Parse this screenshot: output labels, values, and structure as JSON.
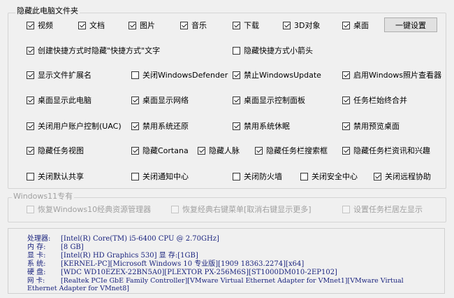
{
  "group1": {
    "title": "隐藏此电脑文件夹",
    "folders": [
      {
        "label": "视频",
        "checked": true
      },
      {
        "label": "文档",
        "checked": true
      },
      {
        "label": "图片",
        "checked": true
      },
      {
        "label": "音乐",
        "checked": true
      },
      {
        "label": "下载",
        "checked": true
      },
      {
        "label": "3D对象",
        "checked": true
      },
      {
        "label": "桌面",
        "checked": true
      }
    ],
    "one_click_label": "一键设置",
    "options": [
      {
        "label": "创建快捷方式时隐藏\"快捷方式\"文字",
        "checked": true
      },
      {
        "label": "隐藏快捷方式小箭头",
        "checked": false
      },
      {
        "label": "显示文件扩展名",
        "checked": true
      },
      {
        "label": "关闭WindowsDefender",
        "checked": false
      },
      {
        "label": "禁止WindowsUpdate",
        "checked": true
      },
      {
        "label": "启用Windows照片查看器",
        "checked": true
      },
      {
        "label": "桌面显示此电脑",
        "checked": true
      },
      {
        "label": "桌面显示网络",
        "checked": true
      },
      {
        "label": "桌面显示控制面板",
        "checked": true
      },
      {
        "label": "任务栏始终合并",
        "checked": true
      },
      {
        "label": "关闭用户账户控制(UAC)",
        "checked": true
      },
      {
        "label": "禁用系统还原",
        "checked": true
      },
      {
        "label": "禁用系统休眠",
        "checked": true
      },
      {
        "label": "禁用预览桌面",
        "checked": true
      },
      {
        "label": "隐藏任务视图",
        "checked": true
      },
      {
        "label": "隐藏Cortana",
        "checked": true
      },
      {
        "label": "隐藏人脉",
        "checked": true
      },
      {
        "label": "隐藏任务栏搜索框",
        "checked": true
      },
      {
        "label": "隐藏任务栏资讯和兴趣",
        "checked": true
      },
      {
        "label": "关闭默认共享",
        "checked": false
      },
      {
        "label": "关闭通知中心",
        "checked": false
      },
      {
        "label": "关闭防火墙",
        "checked": false
      },
      {
        "label": "关闭安全中心",
        "checked": false
      },
      {
        "label": "关闭远程协助",
        "checked": true
      }
    ]
  },
  "group2": {
    "title": "Windows11专有",
    "options": [
      {
        "label": "恢复Windows10经典资源管理器",
        "checked": false
      },
      {
        "label": "恢复经典右键菜单[取消右键显示更多]",
        "checked": false
      },
      {
        "label": "设置任务栏居左显示",
        "checked": false
      }
    ]
  },
  "sysinfo": {
    "lines": [
      {
        "label": "处理器:",
        "value": "[Intel(R) Core(TM) i5-6400 CPU @ 2.70GHz]"
      },
      {
        "label": "内  存:",
        "value": "[8 GB]"
      },
      {
        "label": "显  卡:",
        "value": "[Intel(R) HD Graphics 530]  显 存:[1GB]"
      },
      {
        "label": "系  统:",
        "value": "[KERNEL-PC][Microsoft Windows 10 专业版][1909 18363.2274][x64]"
      },
      {
        "label": "硬  盘:",
        "value": "[WDC WD10EZEX-22BN5A0][PLEXTOR PX-256M6S][ST1000DM010-2EP102]"
      },
      {
        "label": "网  卡:",
        "value": "[Realtek PCIe GbE Family Controller][VMware Virtual Ethernet Adapter for VMnet1][VMware Virtual"
      },
      {
        "label": "",
        "value": "Ethernet Adapter for VMnet8]"
      }
    ]
  }
}
